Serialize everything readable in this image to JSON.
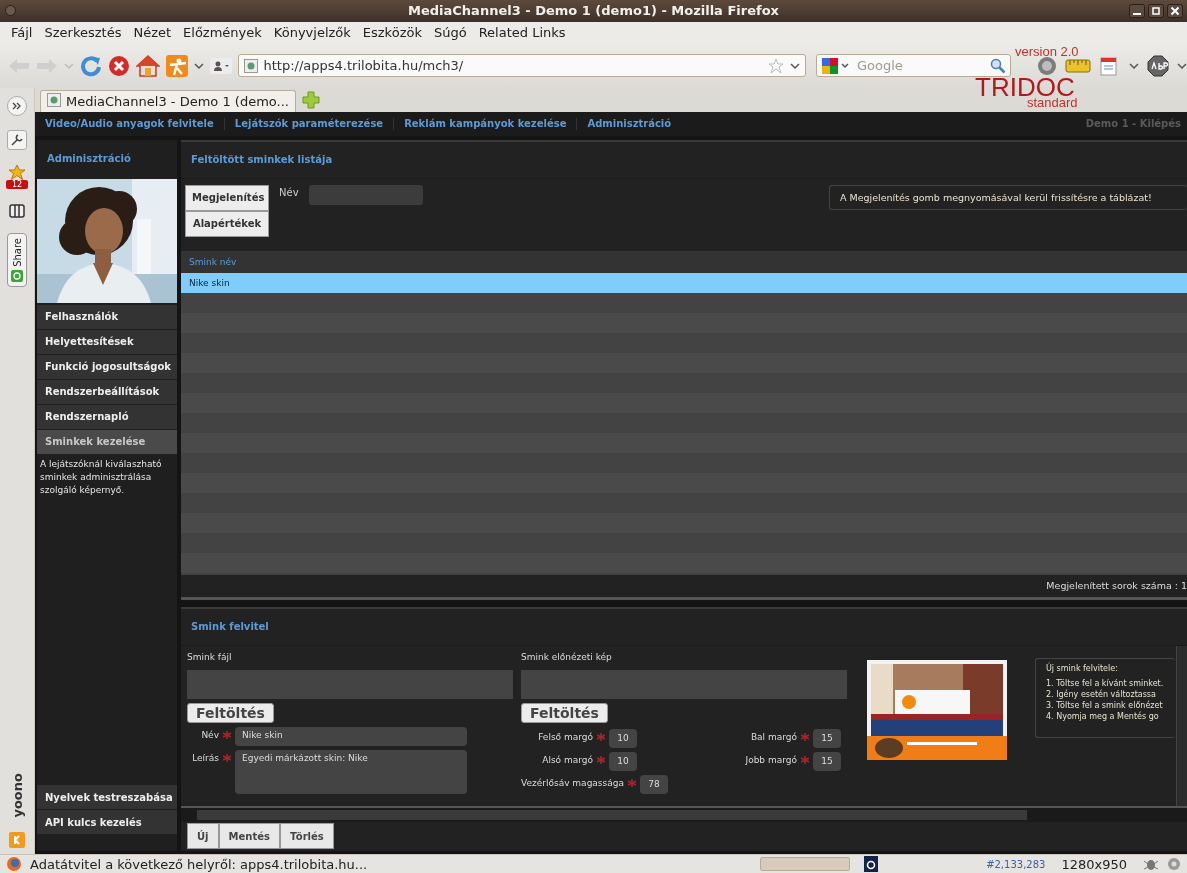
{
  "window": {
    "title": "MediaChannel3 - Demo 1 (demo1) - Mozilla Firefox"
  },
  "menu": [
    "Fájl",
    "Szerkesztés",
    "Nézet",
    "Előzmények",
    "Könyvjelzők",
    "Eszközök",
    "Súgó",
    "Related Links"
  ],
  "toolbar": {
    "url": "http://apps4.trilobita.hu/mch3/",
    "search_placeholder": "Google",
    "theme_logo": [
      "version 2.0",
      "TRIDOC",
      "standard"
    ]
  },
  "sidebar": {
    "badge": "12",
    "share": "Share",
    "brand": "yoono"
  },
  "tabs": [
    {
      "title": "MediaChannel3 - Demo 1 (demo...",
      "selected": true
    }
  ],
  "page": {
    "nav": [
      "Video/Audio anyagok felvitele",
      "Lejátszók paraméterezése",
      "Reklám kampányok kezelése",
      "Adminisztráció"
    ],
    "user_link": "Demo 1 - Kilépés",
    "admin": {
      "title": "Adminisztráció",
      "photo": {
        "kind": "picture"
      },
      "items": [
        {
          "label": "Felhasználók",
          "selected": false
        },
        {
          "label": "Helyettesítések",
          "selected": false
        },
        {
          "label": "Funkció jogosultságok",
          "selected": false
        },
        {
          "label": "Rendszerbeállítások",
          "selected": false
        },
        {
          "label": "Rendszernapló",
          "selected": false
        },
        {
          "label": "Sminkek kezelése",
          "selected": true
        }
      ],
      "description": "A lejátszóknál kiválaszható sminkek adminisztrálása szolgáló képernyő.",
      "bottom_items": [
        "Nyelvek testreszabása",
        "API kulcs kezelés"
      ]
    },
    "list_panel": {
      "title": "Feltöltött sminkek listája",
      "buttons": [
        "Megjelenítés",
        "Alapértékek"
      ],
      "filter_label": "Név",
      "notice": "A Megjelenítés gomb megnyomásával kerül frissítésre a táblázat!",
      "table": {
        "columns": [
          "Smink név"
        ],
        "rows": [
          {
            "cells": [
              "Nike skin"
            ],
            "selected": true
          }
        ]
      },
      "footer": "Megjelenített sorok száma : 1"
    },
    "form_panel": {
      "title": "Smink felvitel",
      "uploads": [
        {
          "label": "Smink fájl",
          "button": "Feltöltés"
        },
        {
          "label": "Smink előnézeti kép",
          "button": "Feltöltés"
        }
      ],
      "fields": [
        {
          "label": "Név",
          "value": "Nike skin",
          "required": true,
          "kind": "input"
        },
        {
          "label": "Leírás",
          "value": "Egyedi márkázott skin: Nike",
          "required": true,
          "kind": "textarea"
        }
      ],
      "margins": [
        {
          "label": "Felső margó",
          "value": "10",
          "required": true
        },
        {
          "label": "Bal margó",
          "value": "15",
          "required": true
        },
        {
          "label": "Alsó margó",
          "value": "10",
          "required": true
        },
        {
          "label": "Jobb margó",
          "value": "15",
          "required": true
        },
        {
          "label": "Vezérlősáv magassága",
          "value": "78",
          "required": true
        }
      ],
      "preview": {
        "kind": "picture"
      },
      "help": {
        "title": "Új smink felvitele:",
        "steps": [
          "1. Töltse fel a kívánt sminket.",
          "2. Igény esetén változtassa",
          "3. Töltse fel a smink előnézet",
          "4. Nyomja meg a Mentés go"
        ]
      },
      "actions": [
        "Új",
        "Mentés",
        "Törlés"
      ]
    }
  },
  "status_bar": {
    "text": "Adatátvitel a következő helyről: apps4.trilobita.hu...",
    "counter": "#2,133,283",
    "resolution": "1280x950"
  }
}
